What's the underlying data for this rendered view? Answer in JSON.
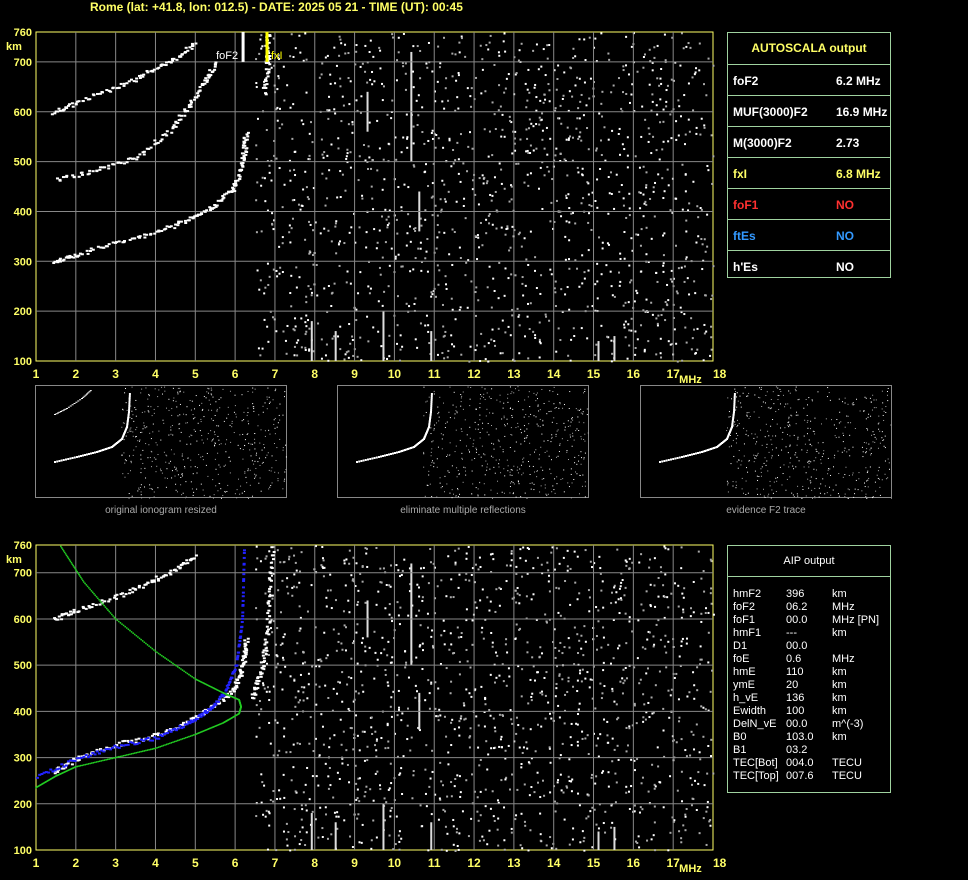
{
  "header": "Rome (lat: +41.8, lon: 012.5) - DATE: 2025 05 21 - TIME (UT): 00:45",
  "autoscala": {
    "title": "AUTOSCALA output",
    "rows": [
      {
        "key": "foF2",
        "value": "6.2 MHz",
        "key_color": "#ffffff",
        "value_color": "#ffffff"
      },
      {
        "key": "MUF(3000)F2",
        "value": "16.9 MHz",
        "key_color": "#ffffff",
        "value_color": "#ffffff"
      },
      {
        "key": "M(3000)F2",
        "value": "2.73",
        "key_color": "#ffffff",
        "value_color": "#ffffff"
      },
      {
        "key": "fxI",
        "value": "6.8 MHz",
        "key_color": "#ffff66",
        "value_color": "#ffff66"
      },
      {
        "key": "foF1",
        "value": "NO",
        "key_color": "#ff3030",
        "value_color": "#ff3030"
      },
      {
        "key": "ftEs",
        "value": "NO",
        "key_color": "#3399ff",
        "value_color": "#3399ff"
      },
      {
        "key": "h'Es",
        "value": "NO",
        "key_color": "#ffffff",
        "value_color": "#ffffff"
      }
    ]
  },
  "aip": {
    "title": "AIP output",
    "rows": [
      [
        "hmF2",
        "396",
        "km"
      ],
      [
        "foF2",
        "06.2",
        "MHz"
      ],
      [
        "foF1",
        "00.0",
        "MHz   [PN]"
      ],
      [
        "hmF1",
        "---",
        "km"
      ],
      [
        "D1",
        "00.0",
        ""
      ],
      [
        "foE",
        "0.6",
        "MHz"
      ],
      [
        "hmE",
        "110",
        "km"
      ],
      [
        "ymE",
        "20",
        "km"
      ],
      [
        "h_vE",
        "136",
        "km"
      ],
      [
        "Ewidth",
        "100",
        "km"
      ],
      [
        "DelN_vE",
        "00.0",
        "m^(-3)"
      ],
      [
        "B0",
        "103.0",
        "km"
      ],
      [
        "B1",
        "03.2",
        ""
      ],
      [
        "TEC[Bot]",
        "004.0",
        "TECU"
      ],
      [
        "TEC[Top]",
        "007.6",
        "TECU"
      ]
    ]
  },
  "thumbnails": [
    {
      "caption": "original ionogram resized"
    },
    {
      "caption": "eliminate multiple reflections"
    },
    {
      "caption": "evidence F2 trace"
    }
  ],
  "chart_data": [
    {
      "type": "scatter",
      "title": "",
      "xlabel": "MHz",
      "ylabel": "km",
      "xlim": [
        1,
        18
      ],
      "ylim": [
        100,
        760
      ],
      "xticks": [
        "1",
        "2",
        "3",
        "4",
        "5",
        "6",
        "7",
        "8",
        "9",
        "10",
        "11",
        "12",
        "13",
        "14",
        "15",
        "16",
        "17",
        "18"
      ],
      "yticks": [
        "100",
        "200",
        "300",
        "400",
        "500",
        "600",
        "700",
        "760"
      ],
      "grid": true,
      "markers": [
        {
          "label": "foF2",
          "x": 6.2,
          "color": "#ffffff"
        },
        {
          "label": "fxI",
          "x": 6.8,
          "color": "#ffff00"
        }
      ],
      "series": [
        {
          "color": "#ffffff",
          "points": [
            [
              1.4,
              300
            ],
            [
              2,
              315
            ],
            [
              3,
              340
            ],
            [
              4,
              360
            ],
            [
              4.8,
              385
            ],
            [
              5.4,
              410
            ],
            [
              5.9,
              445
            ],
            [
              6.1,
              480
            ],
            [
              6.2,
              520
            ],
            [
              6.25,
              560
            ]
          ]
        },
        {
          "color": "#ffffff",
          "points": [
            [
              1.5,
              465
            ],
            [
              2.5,
              485
            ],
            [
              3.5,
              510
            ],
            [
              4.3,
              560
            ],
            [
              4.8,
              610
            ],
            [
              5.2,
              660
            ],
            [
              5.5,
              700
            ]
          ]
        },
        {
          "color": "#ffffff",
          "points": [
            [
              1.4,
              600
            ],
            [
              2,
              620
            ],
            [
              3,
              650
            ],
            [
              3.8,
              680
            ],
            [
              4.5,
              710
            ],
            [
              5,
              740
            ]
          ]
        },
        {
          "color": "#ffffff",
          "points": [
            [
              6.7,
              640
            ],
            [
              6.8,
              700
            ],
            [
              6.8,
              760
            ]
          ]
        }
      ]
    },
    {
      "type": "scatter",
      "title": "",
      "xlabel": "MHz",
      "ylabel": "km",
      "xlim": [
        1,
        18
      ],
      "ylim": [
        100,
        760
      ],
      "xticks": [
        "1",
        "2",
        "3",
        "4",
        "5",
        "6",
        "7",
        "8",
        "9",
        "10",
        "11",
        "12",
        "13",
        "14",
        "15",
        "16",
        "17",
        "18"
      ],
      "yticks": [
        "100",
        "200",
        "300",
        "400",
        "500",
        "600",
        "700",
        "760"
      ],
      "grid": true,
      "series": [
        {
          "color": "#ffffff",
          "points": [
            [
              1.4,
              270
            ],
            [
              2,
              300
            ],
            [
              3,
              330
            ],
            [
              4,
              350
            ],
            [
              4.8,
              380
            ],
            [
              5.4,
              410
            ],
            [
              5.9,
              445
            ],
            [
              6.1,
              480
            ],
            [
              6.2,
              520
            ],
            [
              6.25,
              560
            ]
          ]
        },
        {
          "color": "#ffffff",
          "points": [
            [
              1.4,
              600
            ],
            [
              2,
              620
            ],
            [
              3,
              650
            ],
            [
              3.8,
              680
            ],
            [
              4.5,
              710
            ],
            [
              5,
              740
            ]
          ]
        },
        {
          "color": "#ffffff",
          "points": [
            [
              6.4,
              430
            ],
            [
              6.6,
              480
            ],
            [
              6.75,
              550
            ],
            [
              6.85,
              650
            ],
            [
              6.9,
              760
            ]
          ]
        },
        {
          "color": "#2222ff",
          "points": [
            [
              1,
              260
            ],
            [
              2,
              300
            ],
            [
              3,
              325
            ],
            [
              4,
              345
            ],
            [
              4.8,
              375
            ],
            [
              5.3,
              405
            ],
            [
              5.7,
              440
            ],
            [
              6,
              500
            ],
            [
              6.15,
              600
            ],
            [
              6.2,
              760
            ]
          ]
        },
        {
          "color": "#22cc22",
          "points": [
            [
              1,
              235
            ],
            [
              1.5,
              260
            ],
            [
              2,
              280
            ],
            [
              3,
              300
            ],
            [
              4,
              320
            ],
            [
              5,
              350
            ],
            [
              5.7,
              375
            ],
            [
              6.1,
              395
            ],
            [
              6.15,
              410
            ],
            [
              6.1,
              425
            ],
            [
              5.7,
              440
            ],
            [
              5,
              470
            ],
            [
              4,
              530
            ],
            [
              3,
              600
            ],
            [
              2.2,
              680
            ],
            [
              1.6,
              760
            ]
          ]
        }
      ]
    }
  ]
}
